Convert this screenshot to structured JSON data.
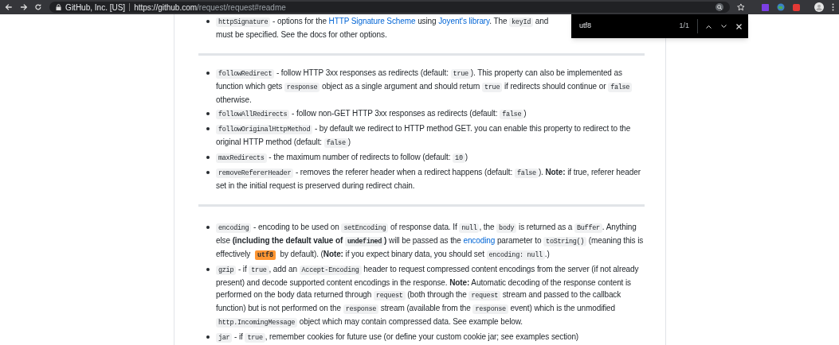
{
  "browser": {
    "site_identity": "GitHub, Inc. [US]",
    "url_host": "https://github.com",
    "url_path": "/request/request#readme"
  },
  "find_bar": {
    "query": "utf8",
    "count": "1/1"
  },
  "sections": [
    {
      "items": [
        [
          {
            "kind": "code",
            "text": "httpSignature"
          },
          {
            "kind": "text",
            "text": " - options for the "
          },
          {
            "kind": "link",
            "text": "HTTP Signature Scheme"
          },
          {
            "kind": "text",
            "text": " using "
          },
          {
            "kind": "link",
            "text": "Joyent's library"
          },
          {
            "kind": "text",
            "text": ". The "
          },
          {
            "kind": "code",
            "text": "keyId"
          },
          {
            "kind": "text",
            "text": " and"
          },
          {
            "kind": "break"
          },
          {
            "kind": "text",
            "text": "must be specified. See the docs for other options."
          }
        ]
      ]
    },
    {
      "items": [
        [
          {
            "kind": "code",
            "text": "followRedirect"
          },
          {
            "kind": "text",
            "text": " - follow HTTP 3xx responses as redirects (default: "
          },
          {
            "kind": "code",
            "text": "true"
          },
          {
            "kind": "text",
            "text": "). This property can also be implemented as function which gets "
          },
          {
            "kind": "code",
            "text": "response"
          },
          {
            "kind": "text",
            "text": " object as a single argument and should return "
          },
          {
            "kind": "code",
            "text": "true"
          },
          {
            "kind": "text",
            "text": " if redirects should continue or "
          },
          {
            "kind": "code",
            "text": "false"
          },
          {
            "kind": "text",
            "text": " otherwise."
          }
        ],
        [
          {
            "kind": "code",
            "text": "followAllRedirects"
          },
          {
            "kind": "text",
            "text": " - follow non-GET HTTP 3xx responses as redirects (default: "
          },
          {
            "kind": "code",
            "text": "false"
          },
          {
            "kind": "text",
            "text": ")"
          }
        ],
        [
          {
            "kind": "code",
            "text": "followOriginalHttpMethod"
          },
          {
            "kind": "text",
            "text": " - by default we redirect to HTTP method GET. you can enable this property to redirect to the original HTTP method (default: "
          },
          {
            "kind": "code",
            "text": "false"
          },
          {
            "kind": "text",
            "text": ")"
          }
        ],
        [
          {
            "kind": "code",
            "text": "maxRedirects"
          },
          {
            "kind": "text",
            "text": " - the maximum number of redirects to follow (default: "
          },
          {
            "kind": "code",
            "text": "10"
          },
          {
            "kind": "text",
            "text": ")"
          }
        ],
        [
          {
            "kind": "code",
            "text": "removeRefererHeader"
          },
          {
            "kind": "text",
            "text": " - removes the referer header when a redirect happens (default: "
          },
          {
            "kind": "code",
            "text": "false"
          },
          {
            "kind": "text",
            "text": "). "
          },
          {
            "kind": "bold",
            "text": "Note:"
          },
          {
            "kind": "text",
            "text": " if true, referer header set in the initial request is preserved during redirect chain."
          }
        ]
      ]
    },
    {
      "items": [
        [
          {
            "kind": "code",
            "text": "encoding"
          },
          {
            "kind": "text",
            "text": " - encoding to be used on "
          },
          {
            "kind": "code",
            "text": "setEncoding"
          },
          {
            "kind": "text",
            "text": " of response data. If "
          },
          {
            "kind": "code",
            "text": "null"
          },
          {
            "kind": "text",
            "text": ", the "
          },
          {
            "kind": "code",
            "text": "body"
          },
          {
            "kind": "text",
            "text": " is returned as a "
          },
          {
            "kind": "code",
            "text": "Buffer"
          },
          {
            "kind": "text",
            "text": ". Anything else "
          },
          {
            "kind": "bold",
            "text": "(including the default value of "
          },
          {
            "kind": "bold_code",
            "text": "undefined"
          },
          {
            "kind": "bold",
            "text": ")"
          },
          {
            "kind": "text",
            "text": " will be passed as the "
          },
          {
            "kind": "link",
            "text": "encoding"
          },
          {
            "kind": "text",
            "text": " parameter to "
          },
          {
            "kind": "code",
            "text": "toString()"
          },
          {
            "kind": "text",
            "text": " (meaning this is effectively "
          },
          {
            "kind": "match",
            "text": "utf8"
          },
          {
            "kind": "text",
            "text": " by default). ("
          },
          {
            "kind": "bold",
            "text": "Note:"
          },
          {
            "kind": "text",
            "text": " if you expect binary data, you should set "
          },
          {
            "kind": "code",
            "text": "encoding: null"
          },
          {
            "kind": "text",
            "text": ".)"
          }
        ],
        [
          {
            "kind": "code",
            "text": "gzip"
          },
          {
            "kind": "text",
            "text": " - if "
          },
          {
            "kind": "code",
            "text": "true"
          },
          {
            "kind": "text",
            "text": ", add an "
          },
          {
            "kind": "code",
            "text": "Accept-Encoding"
          },
          {
            "kind": "text",
            "text": " header to request compressed content encodings from the server (if not already present) and decode supported content encodings in the response. "
          },
          {
            "kind": "bold",
            "text": "Note:"
          },
          {
            "kind": "text",
            "text": " Automatic decoding of the response content is performed on the body data returned through "
          },
          {
            "kind": "code",
            "text": "request"
          },
          {
            "kind": "text",
            "text": " (both through the "
          },
          {
            "kind": "code",
            "text": "request"
          },
          {
            "kind": "text",
            "text": " stream and passed to the callback function) but is not performed on the "
          },
          {
            "kind": "code",
            "text": "response"
          },
          {
            "kind": "text",
            "text": " stream (available from the "
          },
          {
            "kind": "code",
            "text": "response"
          },
          {
            "kind": "text",
            "text": " event) which is the unmodified "
          },
          {
            "kind": "code",
            "text": "http.IncomingMessage"
          },
          {
            "kind": "text",
            "text": " object which may contain compressed data. See example below."
          }
        ],
        [
          {
            "kind": "code",
            "text": "jar"
          },
          {
            "kind": "text",
            "text": " - if "
          },
          {
            "kind": "code",
            "text": "true"
          },
          {
            "kind": "text",
            "text": ", remember cookies for future use (or define your custom cookie jar; see examples section)"
          }
        ]
      ]
    }
  ]
}
